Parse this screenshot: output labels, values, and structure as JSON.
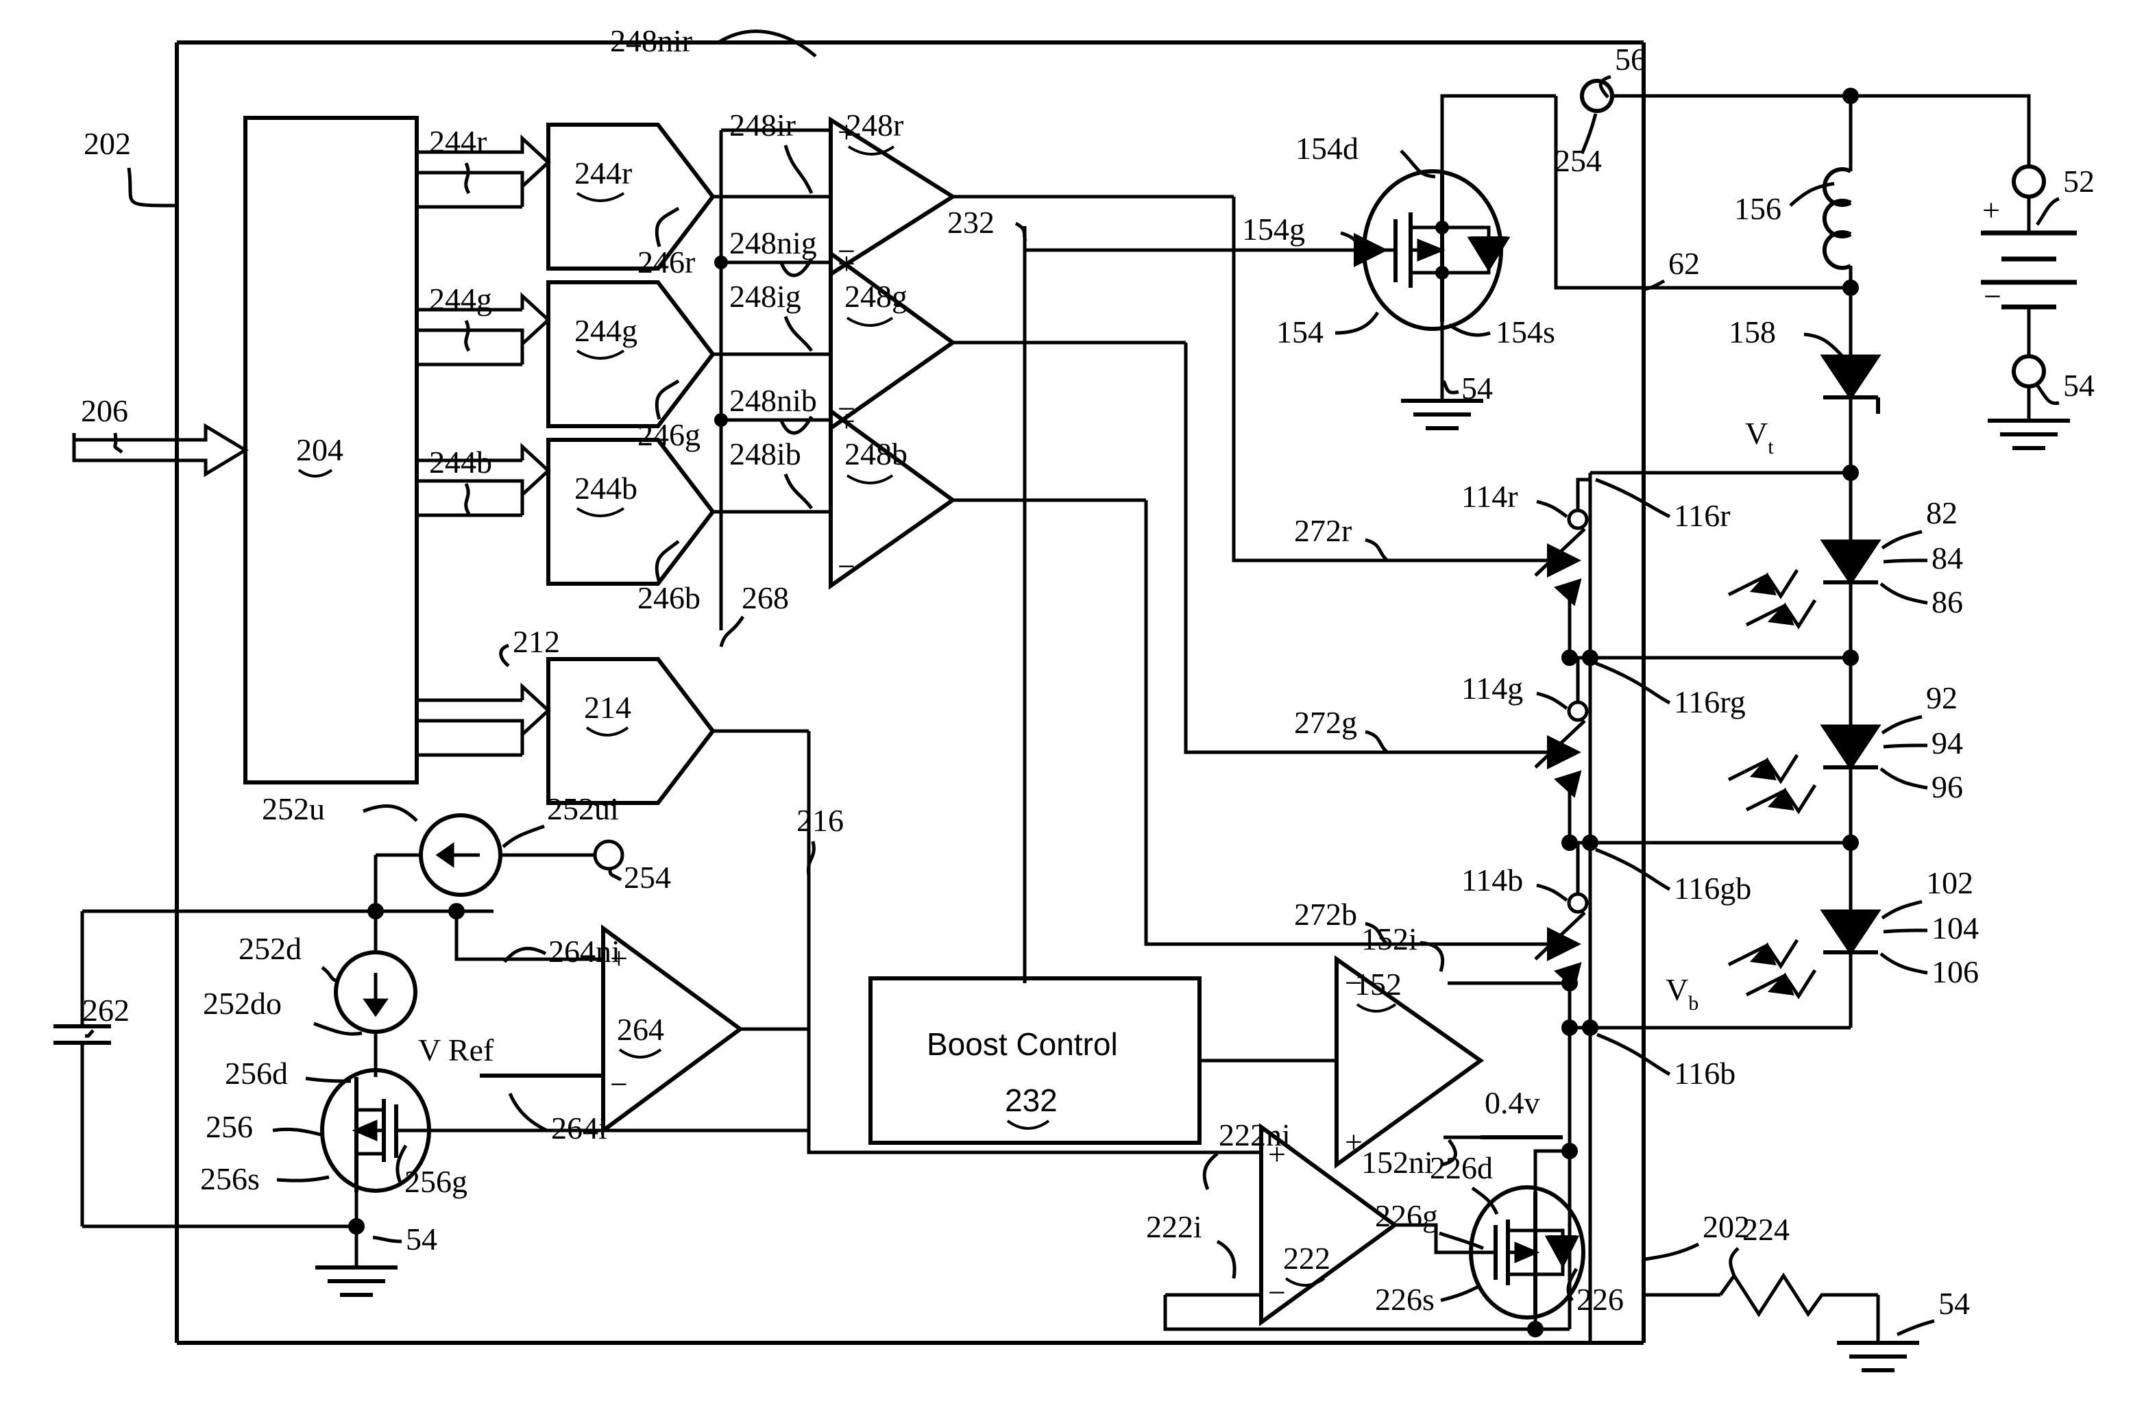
{
  "figure": {
    "title": "LED driver circuit with boost converter and RGB current control",
    "domain": "patent-circuit-diagram",
    "line_color": "#000000",
    "background": "#ffffff"
  },
  "blocks": {
    "controller": "204",
    "input_bus": "206",
    "outer_boundary": "202",
    "boost_control_label": "Boost Control",
    "boost_control_ref": "232",
    "dac_r": "244r",
    "dac_g": "244g",
    "dac_b": "244b",
    "dac_u": "214",
    "bus_r": "244r",
    "bus_g": "244g",
    "bus_b": "244b",
    "bus_u": "212"
  },
  "nets": {
    "n246r": "246r",
    "n246g": "246g",
    "n246b": "246b",
    "n268": "268",
    "n216": "216",
    "n232_lead": "232",
    "n202_right": "202",
    "vref": "V Ref",
    "vt": "V",
    "vt_sub": "t",
    "vb": "V",
    "vb_sub": "b",
    "threshold": "0.4v"
  },
  "comparators": [
    {
      "ref": "248r",
      "plus_in": "248nir",
      "minus_in": "248ir"
    },
    {
      "ref": "248g",
      "plus_in": "248nig",
      "minus_in": "248ig"
    },
    {
      "ref": "248b",
      "plus_in": "248nib",
      "minus_in": "248ib"
    }
  ],
  "opamps": [
    {
      "ref": "264",
      "plus_in": "264ni",
      "minus_in": "264i",
      "minus_label": "V Ref"
    },
    {
      "ref": "152",
      "minus_in": "152i",
      "plus_in": "152ni",
      "plus_label": "0.4v"
    },
    {
      "ref": "222",
      "plus_in": "222ni",
      "minus_in": "222i"
    }
  ],
  "mosfets": [
    {
      "ref": "154",
      "drain": "154d",
      "gate": "154g",
      "source": "154s",
      "ground": "54"
    },
    {
      "ref": "256",
      "drain": "256d",
      "gate": "256g",
      "source": "256s",
      "ground": "54"
    },
    {
      "ref": "226",
      "drain": "226d",
      "gate": "226g",
      "source": "226s"
    }
  ],
  "sources": [
    {
      "ref": "252u",
      "terminal": "252ui",
      "node": "254",
      "type": "current-source-up"
    },
    {
      "ref": "252d",
      "terminal": "252do",
      "type": "current-source-down"
    }
  ],
  "passives": {
    "inductor": "156",
    "diode": "158",
    "battery": "52",
    "capacitor_262": "262",
    "resistor_224": "224",
    "cap_node_56": "56",
    "cap_node_62": "62"
  },
  "grounds": [
    "54",
    "54",
    "54",
    "54"
  ],
  "switch_drivers": [
    {
      "signal": "272r",
      "switch": "114r",
      "string": "116r"
    },
    {
      "signal": "272g",
      "switch": "114g",
      "string": "116rg"
    },
    {
      "signal": "272b",
      "switch": "114b",
      "string": "116gb"
    }
  ],
  "led_bottom_node": "116b",
  "led_strings": [
    {
      "node": "116r",
      "callouts": [
        "82",
        "84",
        "86"
      ]
    },
    {
      "node": "116rg",
      "callouts": [
        "92",
        "94",
        "96"
      ]
    },
    {
      "node": "116gb",
      "callouts": [
        "102",
        "104",
        "106"
      ]
    }
  ],
  "terminals": {
    "t254": "254",
    "t52_plus": "+",
    "t52_minus": "−",
    "t54_right": "54"
  },
  "signs": {
    "plus": "+",
    "minus": "−"
  }
}
